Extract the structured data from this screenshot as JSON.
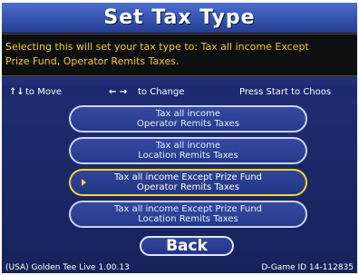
{
  "header": {
    "title": "Set Tax Type"
  },
  "info": {
    "line1": "Selecting this will set your tax type to: Tax all income Except",
    "line2": "Prize Fund, Operator Remits Taxes."
  },
  "hints": {
    "move_glyph": "↑↓",
    "move_label": "to Move",
    "change_glyph": "← →",
    "change_label": "to Change",
    "start_label": "Press Start to Choos"
  },
  "options": [
    {
      "line1": "Tax all income",
      "line2": "Operator Remits Taxes",
      "selected": false
    },
    {
      "line1": "Tax all income",
      "line2": "Location Remits Taxes",
      "selected": false
    },
    {
      "line1": "Tax all income Except Prize Fund",
      "line2": "Operator Remits Taxes",
      "selected": true
    },
    {
      "line1": "Tax all income Except Prize Fund",
      "line2": "Location Remits Taxes",
      "selected": false
    }
  ],
  "back": {
    "label": "Back"
  },
  "footer": {
    "left": "(USA) Golden Tee Live 1.00.13",
    "right": "D-Game ID 14-112835"
  },
  "colors": {
    "accent_yellow": "#f3d23a",
    "info_text": "#f6c818",
    "panel_blue": "#2a3a86"
  },
  "icons": {
    "move": "up-down-arrows-icon",
    "change": "left-right-arrows-icon",
    "selection": "selection-arrow-icon"
  }
}
